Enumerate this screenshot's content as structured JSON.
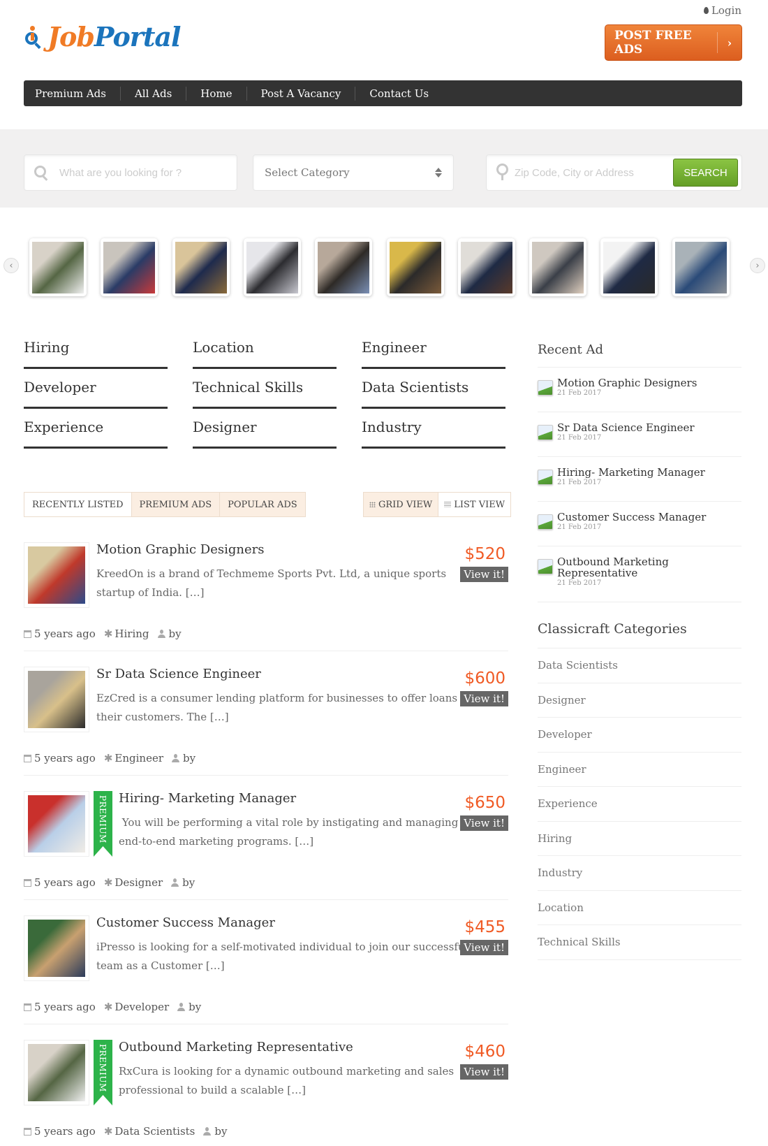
{
  "header": {
    "logo_job": "Job",
    "logo_portal": "Portal",
    "login_label": "Login",
    "post_button_label": "POST FREE ADS",
    "post_button_arrow": "›"
  },
  "nav": {
    "items": [
      "Premium Ads",
      "All Ads",
      "Home",
      "Post A Vacancy",
      "Contact Us"
    ]
  },
  "search": {
    "keyword_placeholder": "What are you looking for ?",
    "category_selected": "Select Category",
    "location_placeholder": "Zip Code, City or Address",
    "search_button_label": "SEARCH"
  },
  "carousel": {
    "prev_icon": "‹",
    "next_icon": "›",
    "thumbnails": [
      {
        "colors": [
          "#d8d2c8",
          "#556644",
          "#f0f0f0"
        ]
      },
      {
        "colors": [
          "#c9c4bd",
          "#2a3b66",
          "#c83a3a"
        ]
      },
      {
        "colors": [
          "#d9c49a",
          "#1e2a4d",
          "#8a6a3a"
        ]
      },
      {
        "colors": [
          "#e6e6ea",
          "#2c2c30",
          "#c8c8d0"
        ]
      },
      {
        "colors": [
          "#b7a89a",
          "#2e2a26",
          "#7a8fb5"
        ]
      },
      {
        "colors": [
          "#d9b84a",
          "#2b2a2a",
          "#7a5a3a"
        ]
      },
      {
        "colors": [
          "#e0ddd8",
          "#1e2a44",
          "#5a3a2a"
        ]
      },
      {
        "colors": [
          "#cfc8c0",
          "#3a3f48",
          "#e0d0c0"
        ]
      },
      {
        "colors": [
          "#f3f3f3",
          "#1f2a44",
          "#2a2a2a"
        ]
      },
      {
        "colors": [
          "#a9b2b8",
          "#2a4a78",
          "#8a8f95"
        ]
      }
    ]
  },
  "tags": [
    [
      "Hiring",
      "Location",
      "Engineer"
    ],
    [
      "Developer",
      "Technical Skills",
      "Data Scientists"
    ],
    [
      "Experience",
      "Designer",
      "Industry"
    ]
  ],
  "tabs": {
    "items": [
      "RECENTLY LISTED",
      "PREMIUM ADS",
      "POPULAR ADS"
    ],
    "active": "RECENTLY LISTED",
    "grid_view_label": "GRID VIEW",
    "list_view_label": "LIST VIEW"
  },
  "listings": [
    {
      "title": "Motion Graphic Designers",
      "description_line1": "KreedOn is a brand of Techmeme Sports Pvt. Ltd, a unique sports",
      "description_line2": "startup of India. […]",
      "price": "$520",
      "view_label": "View it!",
      "posted": "5 years ago",
      "category": "Hiring",
      "by_label": "by",
      "premium": false,
      "img_colors": [
        "#d8c9a0",
        "#c0392b",
        "#2c4a8a"
      ]
    },
    {
      "title": "Sr Data Science Engineer",
      "description_line1": "EzCred is a consumer lending platform for businesses to offer loans to",
      "description_line2": "their customers. The […]",
      "price": "$600",
      "view_label": "View it!",
      "posted": "5 years ago",
      "category": "Engineer",
      "by_label": "by",
      "premium": false,
      "img_colors": [
        "#a9a49c",
        "#d8c08a",
        "#2a2a2a"
      ]
    },
    {
      "title": "Hiring- Marketing Manager",
      "description_line1": " You will be performing a vital role by instigating and managing",
      "description_line2": "end-to-end marketing programs. […]",
      "price": "$650",
      "view_label": "View it!",
      "posted": "5 years ago",
      "category": "Designer",
      "by_label": "by",
      "premium": true,
      "premium_label": "PREMIUM",
      "img_colors": [
        "#c9302c",
        "#b9cfe8",
        "#f0ece6"
      ]
    },
    {
      "title": "Customer Success Manager",
      "description_line1": "iPresso is looking for a self-motivated individual to join our successful",
      "description_line2": "team as a Customer […]",
      "price": "$455",
      "view_label": "View it!",
      "posted": "5 years ago",
      "category": "Developer",
      "by_label": "by",
      "premium": false,
      "img_colors": [
        "#3a6a3a",
        "#c8a070",
        "#2a3a5a"
      ]
    },
    {
      "title": "Outbound Marketing Representative",
      "description_line1": "RxCura is looking for a dynamic outbound marketing and sales",
      "description_line2": "professional to build a scalable […]",
      "price": "$460",
      "view_label": "View it!",
      "posted": "5 years ago",
      "category": "Data Scientists",
      "by_label": "by",
      "premium": true,
      "premium_label": "PREMIUM",
      "img_colors": [
        "#d8d2c8",
        "#556644",
        "#f0f0f0"
      ]
    }
  ],
  "sidebar": {
    "recent_heading": "Recent Ad",
    "recent_ads": [
      {
        "title": "Motion Graphic Designers",
        "date": "21 Feb 2017"
      },
      {
        "title": "Sr Data Science Engineer",
        "date": "21 Feb 2017"
      },
      {
        "title": "Hiring- Marketing Manager",
        "date": "21 Feb 2017"
      },
      {
        "title": "Customer Success Manager",
        "date": "21 Feb 2017"
      },
      {
        "title": "Outbound Marketing Representative",
        "date": "21 Feb 2017"
      }
    ],
    "categories_heading": "Classicraft Categories",
    "categories": [
      "Data Scientists",
      "Designer",
      "Developer",
      "Engineer",
      "Experience",
      "Hiring",
      "Industry",
      "Location",
      "Technical Skills"
    ]
  },
  "colors": {
    "brand_orange": "#f07b26",
    "brand_blue": "#1b74bc",
    "price_orange": "#f05a24",
    "search_green": "#72ad2e",
    "premium_green": "#2db34a",
    "nav_dark": "#333333"
  }
}
